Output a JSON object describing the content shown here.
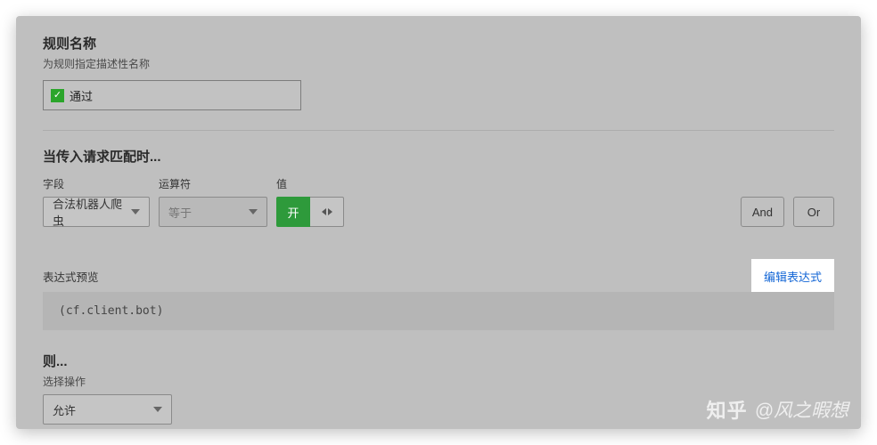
{
  "ruleName": {
    "title": "规则名称",
    "subtitle": "为规则指定描述性名称",
    "value": "通过"
  },
  "condition": {
    "title": "当传入请求匹配时...",
    "fieldLabel": "字段",
    "fieldValue": "合法机器人爬虫",
    "operatorLabel": "运算符",
    "operatorValue": "等于",
    "valueLabel": "值",
    "toggleOn": "开",
    "logic": {
      "and": "And",
      "or": "Or"
    }
  },
  "expression": {
    "previewLabel": "表达式预览",
    "editLabel": "编辑表达式",
    "value": "(cf.client.bot)"
  },
  "then": {
    "title": "则...",
    "subtitle": "选择操作",
    "actionValue": "允许"
  },
  "watermark": {
    "logo": "知乎",
    "author": "@风之暇想"
  }
}
